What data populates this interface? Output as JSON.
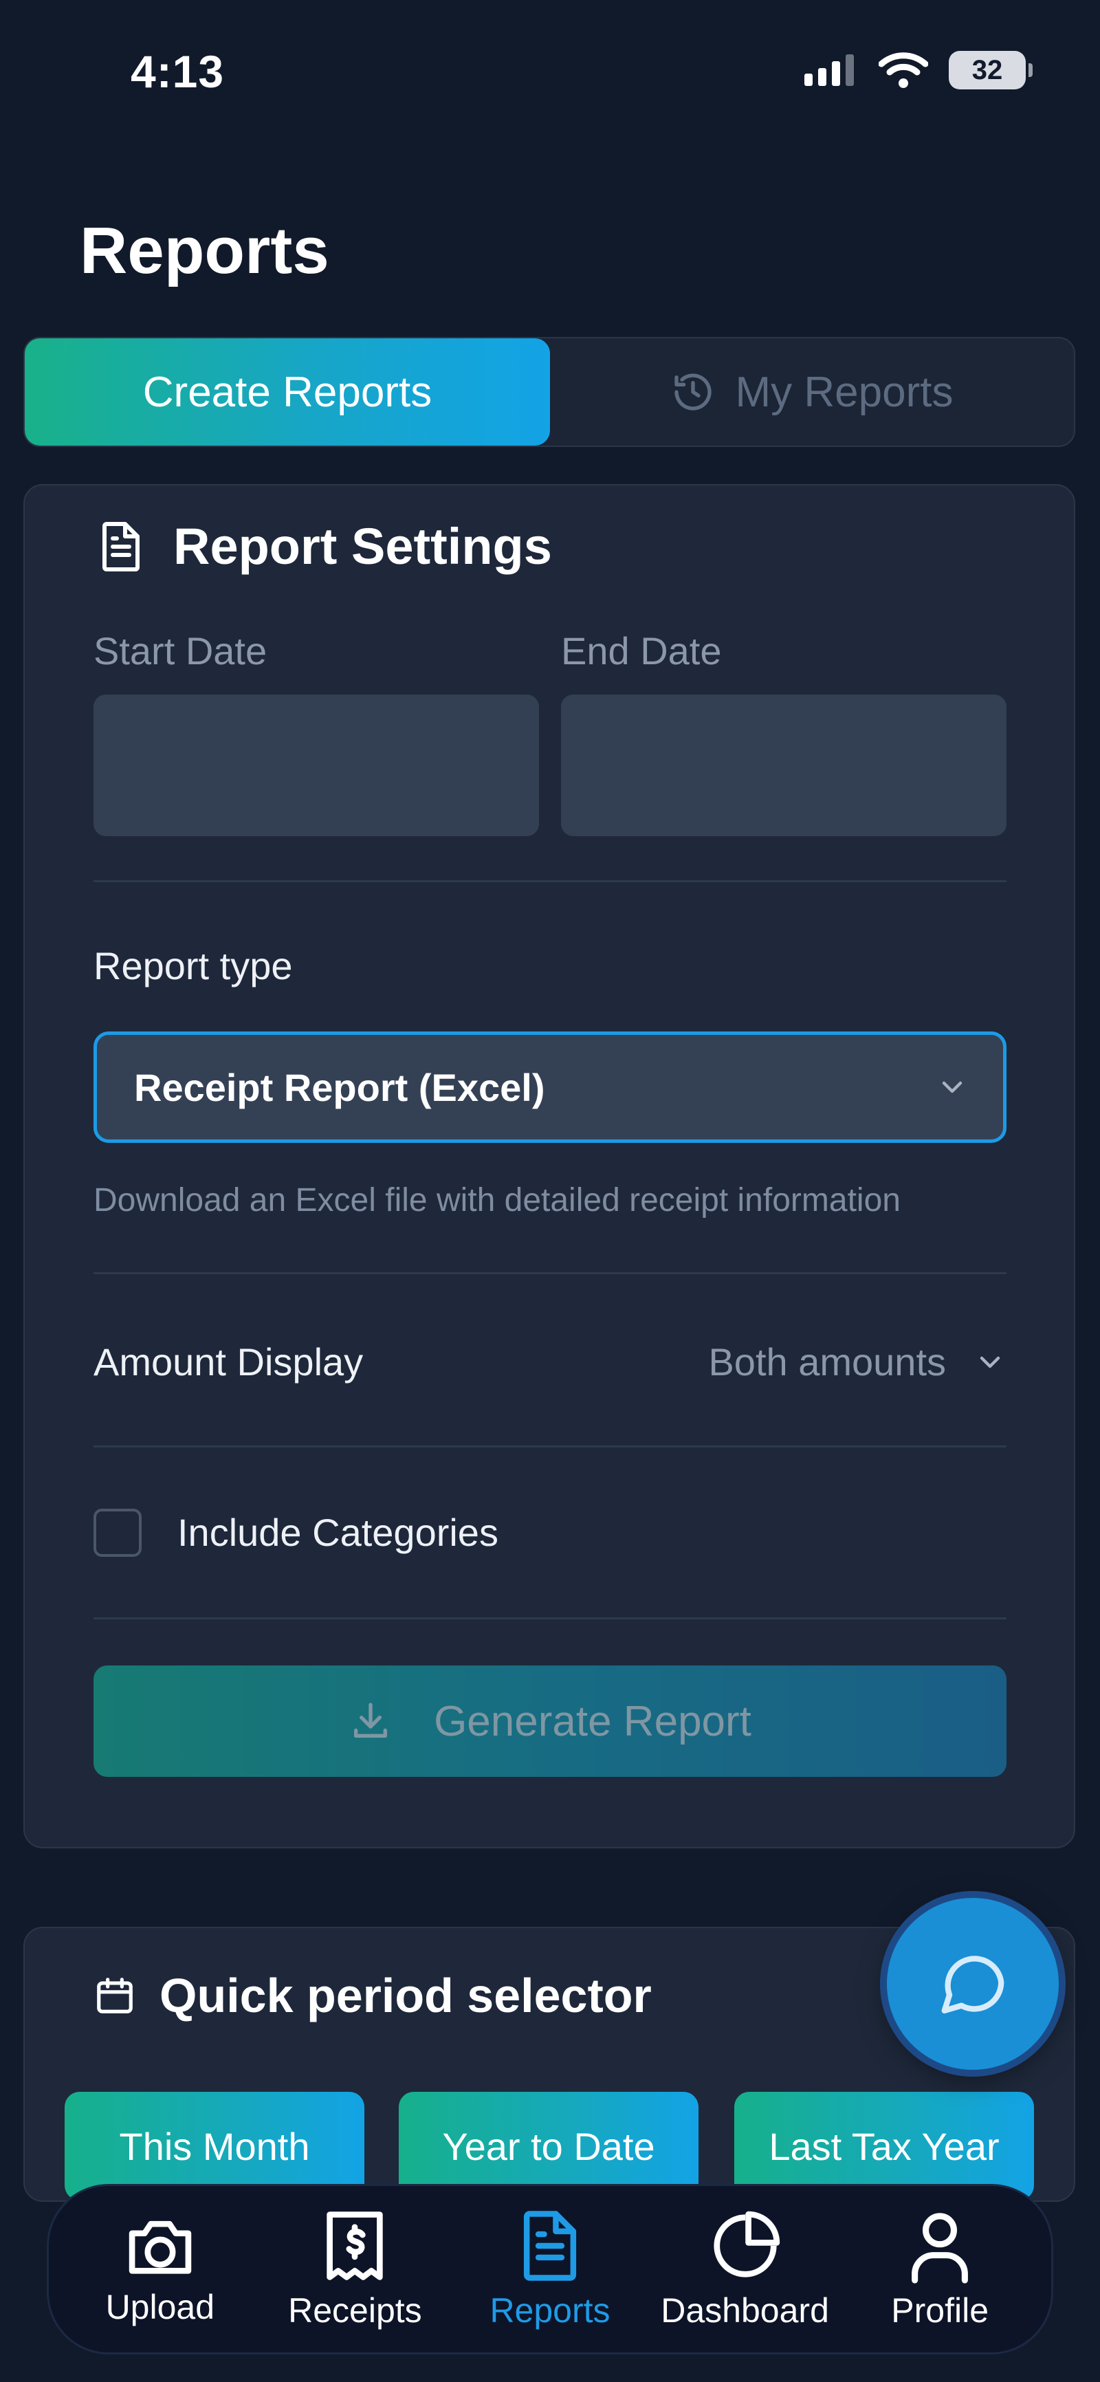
{
  "status_bar": {
    "time": "4:13",
    "battery": "32"
  },
  "page": {
    "title": "Reports"
  },
  "tabs": [
    {
      "label": "Create Reports",
      "active": true
    },
    {
      "label": "My Reports",
      "active": false,
      "icon": "history-icon"
    }
  ],
  "settings": {
    "title": "Report Settings",
    "start_date_label": "Start Date",
    "end_date_label": "End Date",
    "start_date_value": "",
    "end_date_value": "",
    "report_type_label": "Report type",
    "report_type_value": "Receipt Report (Excel)",
    "report_type_help": "Download an Excel file with detailed receipt information",
    "amount_display_label": "Amount Display",
    "amount_display_value": "Both amounts",
    "include_categories_label": "Include Categories",
    "include_categories_checked": false,
    "generate_label": "Generate Report"
  },
  "quick_period": {
    "title": "Quick period selector",
    "options": [
      "This Month",
      "Year to Date",
      "Last Tax Year"
    ]
  },
  "nav": {
    "items": [
      {
        "label": "Upload",
        "icon": "camera-icon"
      },
      {
        "label": "Receipts",
        "icon": "receipt-icon"
      },
      {
        "label": "Reports",
        "icon": "document-icon",
        "active": true
      },
      {
        "label": "Dashboard",
        "icon": "pie-chart-icon"
      },
      {
        "label": "Profile",
        "icon": "person-icon"
      }
    ]
  },
  "colors": {
    "accent": "#1f9be6",
    "gradient_start": "#19b18a",
    "background": "#111a2b",
    "card": "#1e283a"
  }
}
